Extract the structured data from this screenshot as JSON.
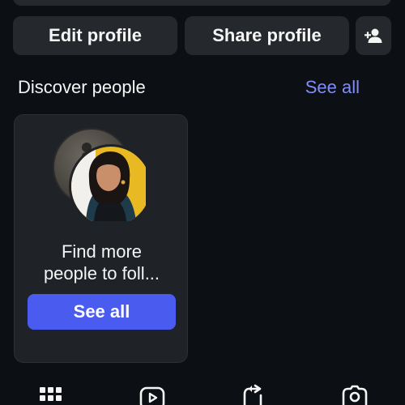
{
  "profile_actions": {
    "edit_label": "Edit profile",
    "share_label": "Share profile",
    "add_user_icon": "add-person-icon"
  },
  "discover": {
    "title": "Discover people",
    "see_all_label": "See all",
    "see_all_color": "#818cf8",
    "card": {
      "text_line1": "Find more",
      "text_line2": "people to foll...",
      "button_label": "See all",
      "button_color": "#4a5cf0"
    }
  },
  "tabs": [
    {
      "icon": "grid-icon",
      "active": true
    },
    {
      "icon": "reels-icon",
      "active": false
    },
    {
      "icon": "repost-icon",
      "active": false
    },
    {
      "icon": "tagged-photo-icon",
      "active": false
    }
  ],
  "colors": {
    "background": "#0c1014",
    "button_bg": "#25292e",
    "text": "#f5f5f5"
  }
}
